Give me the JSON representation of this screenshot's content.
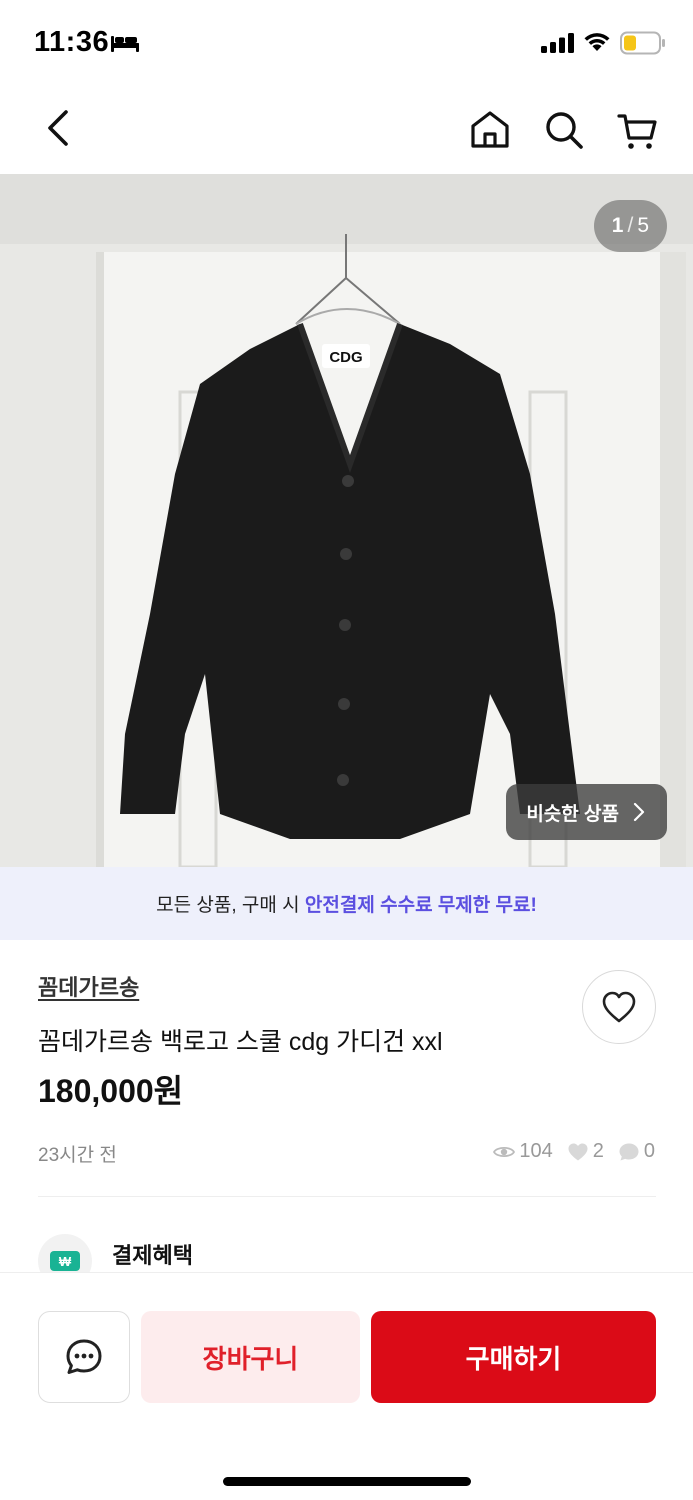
{
  "status_bar": {
    "time": "11:36"
  },
  "image": {
    "current": "1",
    "separator": "/",
    "total": "5",
    "logo_text": "CDG"
  },
  "similar_button_label": "비슷한 상품",
  "promo": {
    "prefix": "모든 상품, 구매 시 ",
    "highlight": "안전결제 수수료 무제한 무료!"
  },
  "product": {
    "brand": "꼼데가르송",
    "title": "꼼데가르송 백로고 스쿨 cdg 가디건 xxl",
    "price": "180,000원",
    "posted": "23시간 전",
    "views": "104",
    "likes": "2",
    "chats": "0"
  },
  "benefit": {
    "title": "결제혜택"
  },
  "bottom": {
    "cart_label": "장바구니",
    "buy_label": "구매하기"
  },
  "colors": {
    "buy": "#db0b17",
    "cart_bg": "#fdeced",
    "cart_text": "#e0202a",
    "promo_highlight": "#5b4fe0",
    "promo_bg": "#eef0fb"
  },
  "icons": [
    "bed-icon",
    "signal-icon",
    "wifi-icon",
    "battery-icon",
    "back-arrow-icon",
    "home-icon",
    "search-icon",
    "cart-icon",
    "chevron-right-icon",
    "heart-icon",
    "eye-icon",
    "chat-bubble-icon",
    "won-icon"
  ]
}
